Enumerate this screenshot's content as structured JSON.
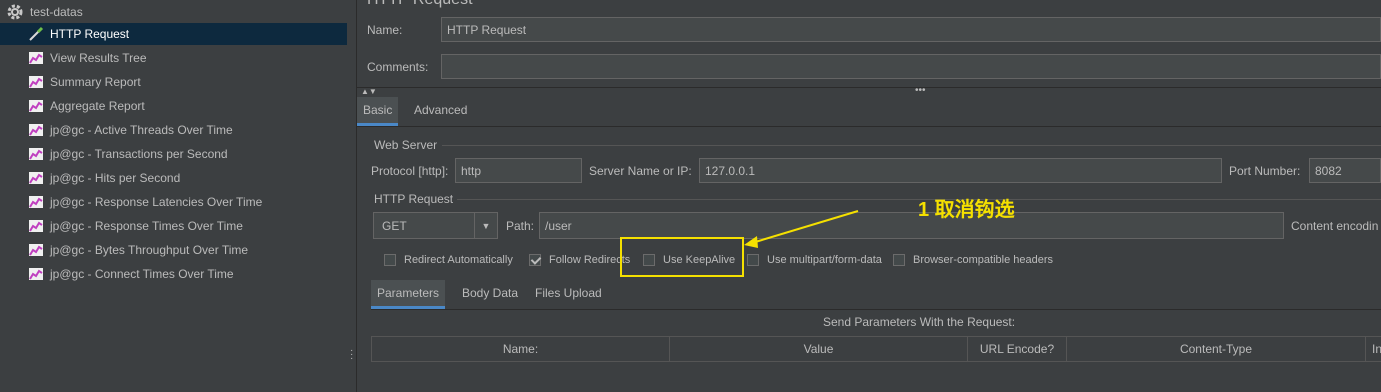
{
  "tree": {
    "root_label": "test-datas",
    "items": [
      {
        "label": "HTTP Request",
        "icon": "pipette-icon",
        "selected": true
      },
      {
        "label": "View Results Tree",
        "icon": "graph-icon"
      },
      {
        "label": "Summary Report",
        "icon": "graph-icon"
      },
      {
        "label": "Aggregate Report",
        "icon": "graph-icon"
      },
      {
        "label": "jp@gc - Active Threads Over Time",
        "icon": "graph-icon"
      },
      {
        "label": "jp@gc - Transactions per Second",
        "icon": "graph-icon"
      },
      {
        "label": "jp@gc - Hits per Second",
        "icon": "graph-icon"
      },
      {
        "label": "jp@gc - Response Latencies Over Time",
        "icon": "graph-icon"
      },
      {
        "label": "jp@gc - Response Times Over Time",
        "icon": "graph-icon"
      },
      {
        "label": "jp@gc - Bytes Throughput Over Time",
        "icon": "graph-icon"
      },
      {
        "label": "jp@gc - Connect Times Over Time",
        "icon": "graph-icon"
      }
    ]
  },
  "panel": {
    "title_partial": "HTTP Request",
    "name_label": "Name:",
    "name_value": "HTTP Request",
    "comments_label": "Comments:",
    "comments_value": ""
  },
  "tabs": {
    "basic": "Basic",
    "advanced": "Advanced"
  },
  "web_server": {
    "group_label": "Web Server",
    "protocol_label": "Protocol [http]:",
    "protocol_value": "http",
    "server_label": "Server Name or IP:",
    "server_value": "127.0.0.1",
    "port_label": "Port Number:",
    "port_value": "8082"
  },
  "http_request": {
    "group_label": "HTTP Request",
    "method": "GET",
    "path_label": "Path:",
    "path_value": "/user",
    "content_encoding_label": "Content encodin"
  },
  "options": [
    {
      "label": "Redirect Automatically",
      "checked": false
    },
    {
      "label": "Follow Redirects",
      "checked": true
    },
    {
      "label": "Use KeepAlive",
      "checked": false
    },
    {
      "label": "Use multipart/form-data",
      "checked": false
    },
    {
      "label": "Browser-compatible headers",
      "checked": false
    }
  ],
  "sub_tabs": {
    "parameters": "Parameters",
    "body_data": "Body Data",
    "files_upload": "Files Upload"
  },
  "params_table": {
    "caption": "Send Parameters With the Request:",
    "columns": [
      "Name:",
      "Value",
      "URL Encode?",
      "Content-Type",
      "In"
    ]
  },
  "annotation": {
    "text": "1 取消钩选",
    "color": "#f5e000"
  }
}
